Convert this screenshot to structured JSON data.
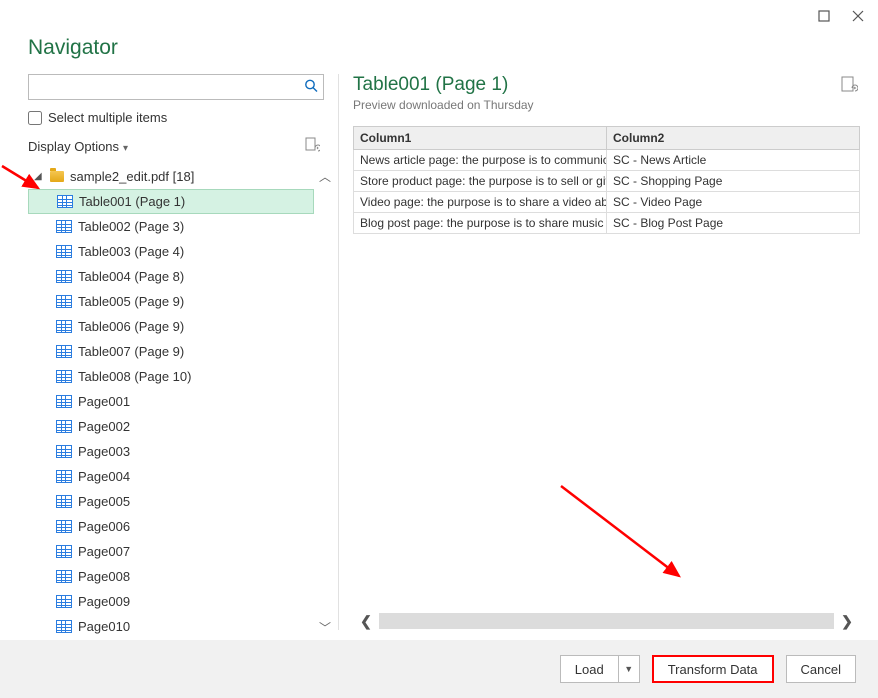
{
  "window": {
    "title": "Navigator",
    "checkbox_label": "Select multiple items",
    "display_options_label": "Display Options",
    "search_placeholder": ""
  },
  "tree": {
    "root_label": "sample2_edit.pdf [18]",
    "items": [
      {
        "label": "Table001 (Page 1)",
        "type": "table",
        "selected": true
      },
      {
        "label": "Table002 (Page 3)",
        "type": "table",
        "selected": false
      },
      {
        "label": "Table003 (Page 4)",
        "type": "table",
        "selected": false
      },
      {
        "label": "Table004 (Page 8)",
        "type": "table",
        "selected": false
      },
      {
        "label": "Table005 (Page 9)",
        "type": "table",
        "selected": false
      },
      {
        "label": "Table006 (Page 9)",
        "type": "table",
        "selected": false
      },
      {
        "label": "Table007 (Page 9)",
        "type": "table",
        "selected": false
      },
      {
        "label": "Table008 (Page 10)",
        "type": "table",
        "selected": false
      },
      {
        "label": "Page001",
        "type": "page",
        "selected": false
      },
      {
        "label": "Page002",
        "type": "page",
        "selected": false
      },
      {
        "label": "Page003",
        "type": "page",
        "selected": false
      },
      {
        "label": "Page004",
        "type": "page",
        "selected": false
      },
      {
        "label": "Page005",
        "type": "page",
        "selected": false
      },
      {
        "label": "Page006",
        "type": "page",
        "selected": false
      },
      {
        "label": "Page007",
        "type": "page",
        "selected": false
      },
      {
        "label": "Page008",
        "type": "page",
        "selected": false
      },
      {
        "label": "Page009",
        "type": "page",
        "selected": false
      },
      {
        "label": "Page010",
        "type": "page",
        "selected": false
      }
    ]
  },
  "preview": {
    "title": "Table001 (Page 1)",
    "subtitle": "Preview downloaded on Thursday",
    "columns": [
      "Column1",
      "Column2"
    ],
    "rows": [
      [
        "News article page: the purpose is to communicate information about an e",
        "SC - News Article"
      ],
      [
        "Store product page: the purpose is to sell or give information about the pr",
        "SC - Shopping Page"
      ],
      [
        "Video page: the purpose is to share a video about cats.",
        "SC - Video Page"
      ],
      [
        "Blog post page: the purpose is to share music used on a TV show.",
        "SC - Blog Post Page"
      ]
    ]
  },
  "footer": {
    "load_label": "Load",
    "transform_label": "Transform Data",
    "cancel_label": "Cancel"
  }
}
